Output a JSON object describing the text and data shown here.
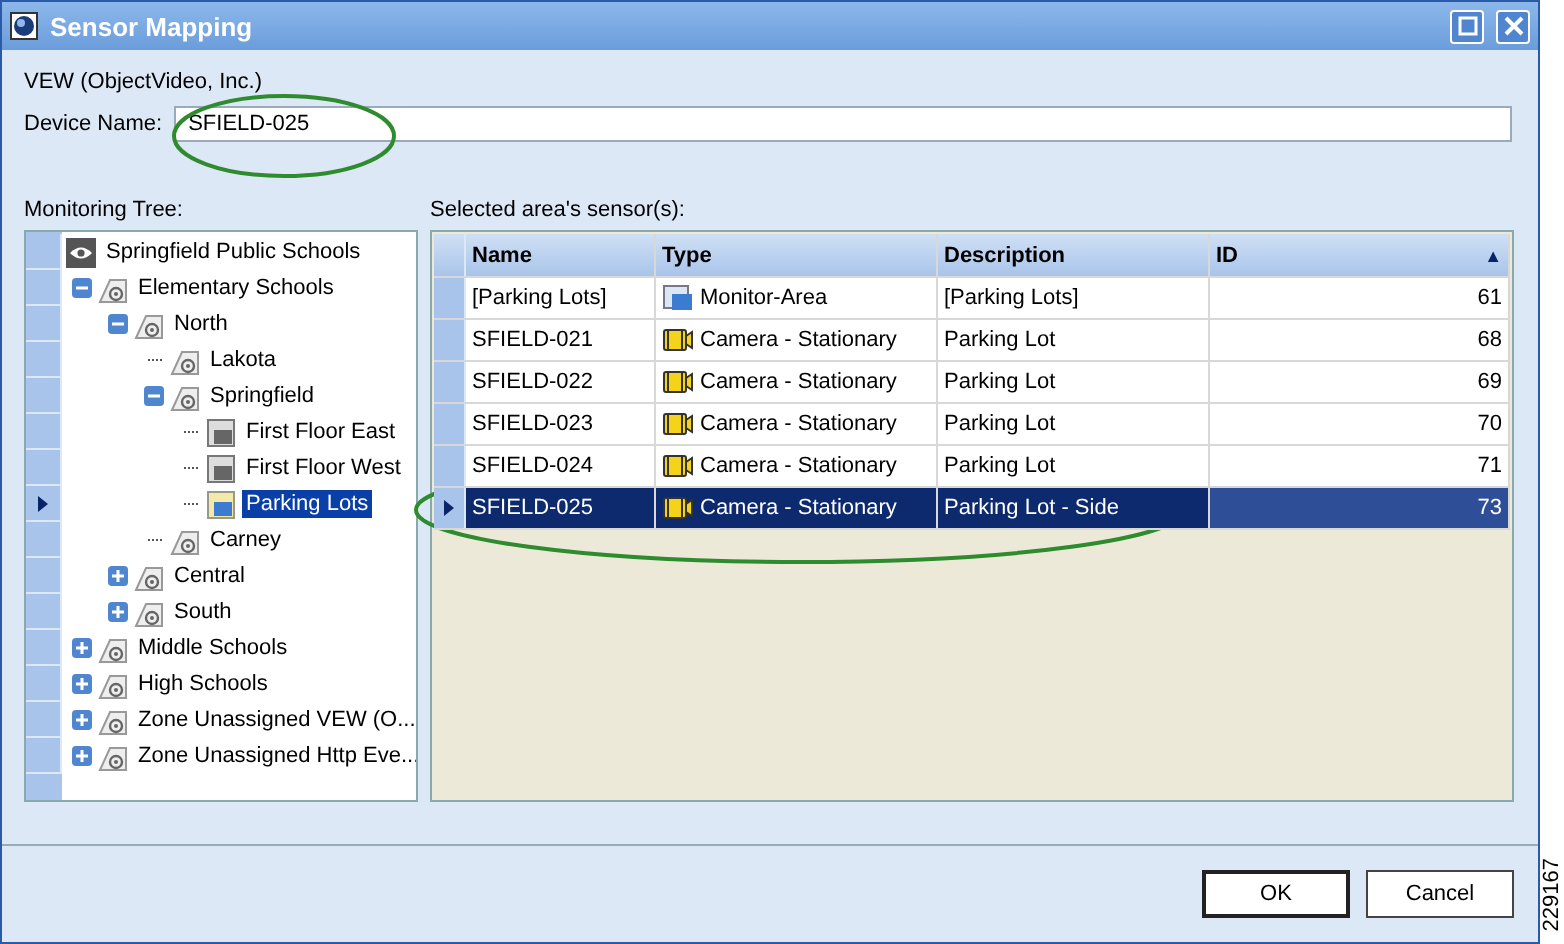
{
  "window": {
    "title": "Sensor Mapping"
  },
  "vendor": "VEW (ObjectVideo, Inc.)",
  "device_name": {
    "label": "Device Name:",
    "value": "SFIELD-025"
  },
  "tree": {
    "label": "Monitoring Tree:",
    "items": [
      {
        "label": "Springfield Public Schools",
        "kind": "root",
        "selected": false,
        "children": [
          {
            "label": "Elementary Schools",
            "kind": "zone",
            "expanded": true,
            "selected": false,
            "children": [
              {
                "label": "North",
                "kind": "zone",
                "expanded": true,
                "selected": false,
                "children": [
                  {
                    "label": "Lakota",
                    "kind": "zone",
                    "selected": false
                  },
                  {
                    "label": "Springfield",
                    "kind": "zone",
                    "expanded": true,
                    "selected": false,
                    "children": [
                      {
                        "label": "First Floor East",
                        "kind": "floor",
                        "selected": false
                      },
                      {
                        "label": "First Floor West",
                        "kind": "floor",
                        "selected": false
                      },
                      {
                        "label": "Parking Lots",
                        "kind": "area",
                        "selected": true
                      }
                    ]
                  },
                  {
                    "label": "Carney",
                    "kind": "zone",
                    "selected": false
                  }
                ]
              },
              {
                "label": "Central",
                "kind": "zone",
                "expanded": false,
                "selected": false
              },
              {
                "label": "South",
                "kind": "zone",
                "expanded": false,
                "selected": false
              }
            ]
          },
          {
            "label": "Middle Schools",
            "kind": "zone",
            "expanded": false,
            "selected": false
          },
          {
            "label": "High Schools",
            "kind": "zone",
            "expanded": false,
            "selected": false
          },
          {
            "label": "Zone Unassigned VEW (O...",
            "kind": "zone",
            "expanded": false,
            "selected": false
          },
          {
            "label": "Zone Unassigned Http Eve...",
            "kind": "zone",
            "expanded": false,
            "selected": false
          }
        ]
      }
    ]
  },
  "sensors": {
    "label": "Selected area's sensor(s):",
    "columns": [
      "Name",
      "Type",
      "Description",
      "ID"
    ],
    "sort_indicator": "▲",
    "rows": [
      {
        "name": "[Parking Lots]",
        "type": "Monitor-Area",
        "kind": "area",
        "description": "[Parking Lots]",
        "id": "61",
        "selected": false
      },
      {
        "name": "SFIELD-021",
        "type": "Camera - Stationary",
        "kind": "camera",
        "description": "Parking Lot",
        "id": "68",
        "selected": false
      },
      {
        "name": "SFIELD-022",
        "type": "Camera - Stationary",
        "kind": "camera",
        "description": "Parking Lot",
        "id": "69",
        "selected": false
      },
      {
        "name": "SFIELD-023",
        "type": "Camera - Stationary",
        "kind": "camera",
        "description": "Parking Lot",
        "id": "70",
        "selected": false
      },
      {
        "name": "SFIELD-024",
        "type": "Camera - Stationary",
        "kind": "camera",
        "description": "Parking Lot",
        "id": "71",
        "selected": false
      },
      {
        "name": "SFIELD-025",
        "type": "Camera - Stationary",
        "kind": "camera",
        "description": "Parking Lot - Side",
        "id": "73",
        "selected": true
      }
    ]
  },
  "buttons": [
    "OK",
    "Cancel"
  ],
  "figure_number": "229167"
}
